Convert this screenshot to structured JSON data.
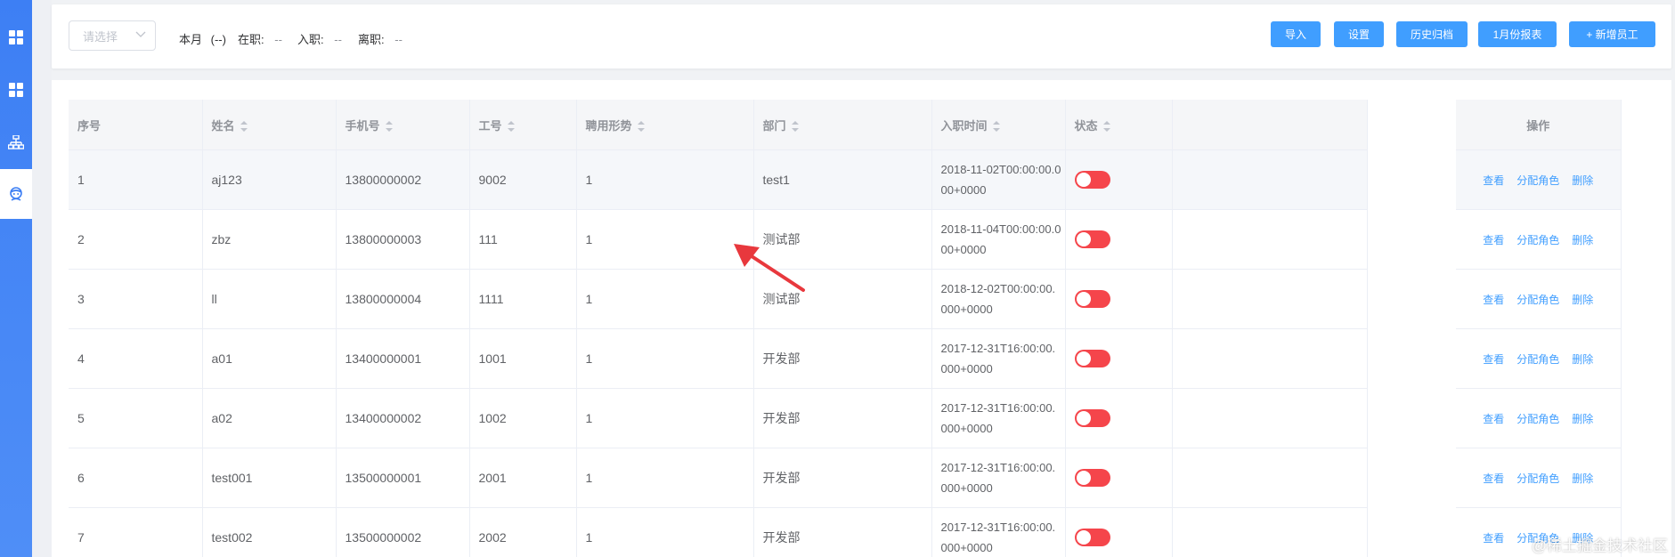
{
  "sidebar": {
    "items": [
      {
        "icon": "grid-icon"
      },
      {
        "icon": "grid-icon"
      },
      {
        "icon": "org-chart-icon"
      },
      {
        "icon": "employee-icon",
        "active": true
      }
    ]
  },
  "toolbar": {
    "select_placeholder": "请选择",
    "month_label": "本月",
    "month_value": "(--)",
    "employed_label": "在职:",
    "employed_value": "--",
    "joined_label": "入职:",
    "joined_value": "--",
    "left_label": "离职:",
    "left_value": "--",
    "buttons": {
      "import": "导入",
      "settings": "设置",
      "history": "历史归档",
      "report": "1月份报表",
      "add_employee": "+ 新增员工"
    }
  },
  "table": {
    "headers": {
      "index": "序号",
      "name": "姓名",
      "phone": "手机号",
      "work_no": "工号",
      "employment_type": "聘用形势",
      "department": "部门",
      "hire_time": "入职时间",
      "status": "状态",
      "actions": "操作"
    },
    "action_labels": {
      "view": "查看",
      "assign_role": "分配角色",
      "delete": "删除"
    },
    "rows": [
      {
        "index": "1",
        "name": "aj123",
        "phone": "13800000002",
        "work_no": "9002",
        "employment_type": "1",
        "department": "test1",
        "hire_time": "2018-11-02T00:00:00.000+0000",
        "status": "off"
      },
      {
        "index": "2",
        "name": "zbz",
        "phone": "13800000003",
        "work_no": "111",
        "employment_type": "1",
        "department": "测试部",
        "hire_time": "2018-11-04T00:00:00.000+0000",
        "status": "off"
      },
      {
        "index": "3",
        "name": "ll",
        "phone": "13800000004",
        "work_no": "1111",
        "employment_type": "1",
        "department": "测试部",
        "hire_time": "2018-12-02T00:00:00.000+0000",
        "status": "off"
      },
      {
        "index": "4",
        "name": "a01",
        "phone": "13400000001",
        "work_no": "1001",
        "employment_type": "1",
        "department": "开发部",
        "hire_time": "2017-12-31T16:00:00.000+0000",
        "status": "off"
      },
      {
        "index": "5",
        "name": "a02",
        "phone": "13400000002",
        "work_no": "1002",
        "employment_type": "1",
        "department": "开发部",
        "hire_time": "2017-12-31T16:00:00.000+0000",
        "status": "off"
      },
      {
        "index": "6",
        "name": "test001",
        "phone": "13500000001",
        "work_no": "2001",
        "employment_type": "1",
        "department": "开发部",
        "hire_time": "2017-12-31T16:00:00.000+0000",
        "status": "off"
      },
      {
        "index": "7",
        "name": "test002",
        "phone": "13500000002",
        "work_no": "2002",
        "employment_type": "1",
        "department": "开发部",
        "hire_time": "2017-12-31T16:00:00.000+0000",
        "status": "off"
      }
    ]
  },
  "colors": {
    "primary": "#409eff",
    "sidebar": "#4f8ef7",
    "switch_off": "#f5454b",
    "annotation_arrow": "#e8383d"
  },
  "watermark": "@稀土掘金技术社区"
}
